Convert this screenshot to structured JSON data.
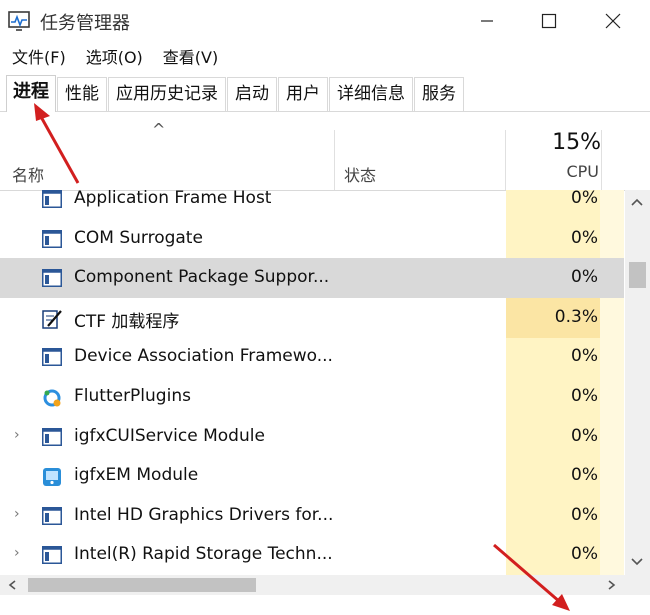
{
  "window": {
    "title": "任务管理器",
    "icon": "task-manager-icon",
    "controls": [
      "minimize",
      "maximize",
      "close"
    ]
  },
  "menu": [
    "文件(F)",
    "选项(O)",
    "查看(V)"
  ],
  "tabs": [
    {
      "label": "进程",
      "active": true
    },
    {
      "label": "性能"
    },
    {
      "label": "应用历史记录"
    },
    {
      "label": "启动"
    },
    {
      "label": "用户"
    },
    {
      "label": "详细信息"
    },
    {
      "label": "服务"
    }
  ],
  "columns": {
    "sort_indicator": "^",
    "name": "名称",
    "status": "状态",
    "cpu_total": "15%",
    "cpu": "CPU"
  },
  "processes": [
    {
      "name": "Application Frame Host",
      "cpu": "0%",
      "icon": "window-app-icon",
      "expandable": false
    },
    {
      "name": "COM Surrogate",
      "cpu": "0%",
      "icon": "window-app-icon",
      "expandable": false
    },
    {
      "name": "Component Package Suppor...",
      "cpu": "0%",
      "icon": "window-app-icon",
      "expandable": false,
      "selected": true
    },
    {
      "name": "CTF 加载程序",
      "cpu": "0.3%",
      "icon": "pen-notepad-icon",
      "expandable": false
    },
    {
      "name": "Device Association Framewo...",
      "cpu": "0%",
      "icon": "window-app-icon",
      "expandable": false
    },
    {
      "name": "FlutterPlugins",
      "cpu": "0%",
      "icon": "flutter-plugins-icon",
      "expandable": false
    },
    {
      "name": "igfxCUIService Module",
      "cpu": "0%",
      "icon": "window-app-icon",
      "expandable": true
    },
    {
      "name": "igfxEM Module",
      "cpu": "0%",
      "icon": "graphics-monitor-icon",
      "expandable": false
    },
    {
      "name": "Intel HD Graphics Drivers for...",
      "cpu": "0%",
      "icon": "window-app-icon",
      "expandable": true
    },
    {
      "name": "Intel(R) Rapid Storage Techn...",
      "cpu": "0%",
      "icon": "window-app-icon",
      "expandable": true
    }
  ]
}
